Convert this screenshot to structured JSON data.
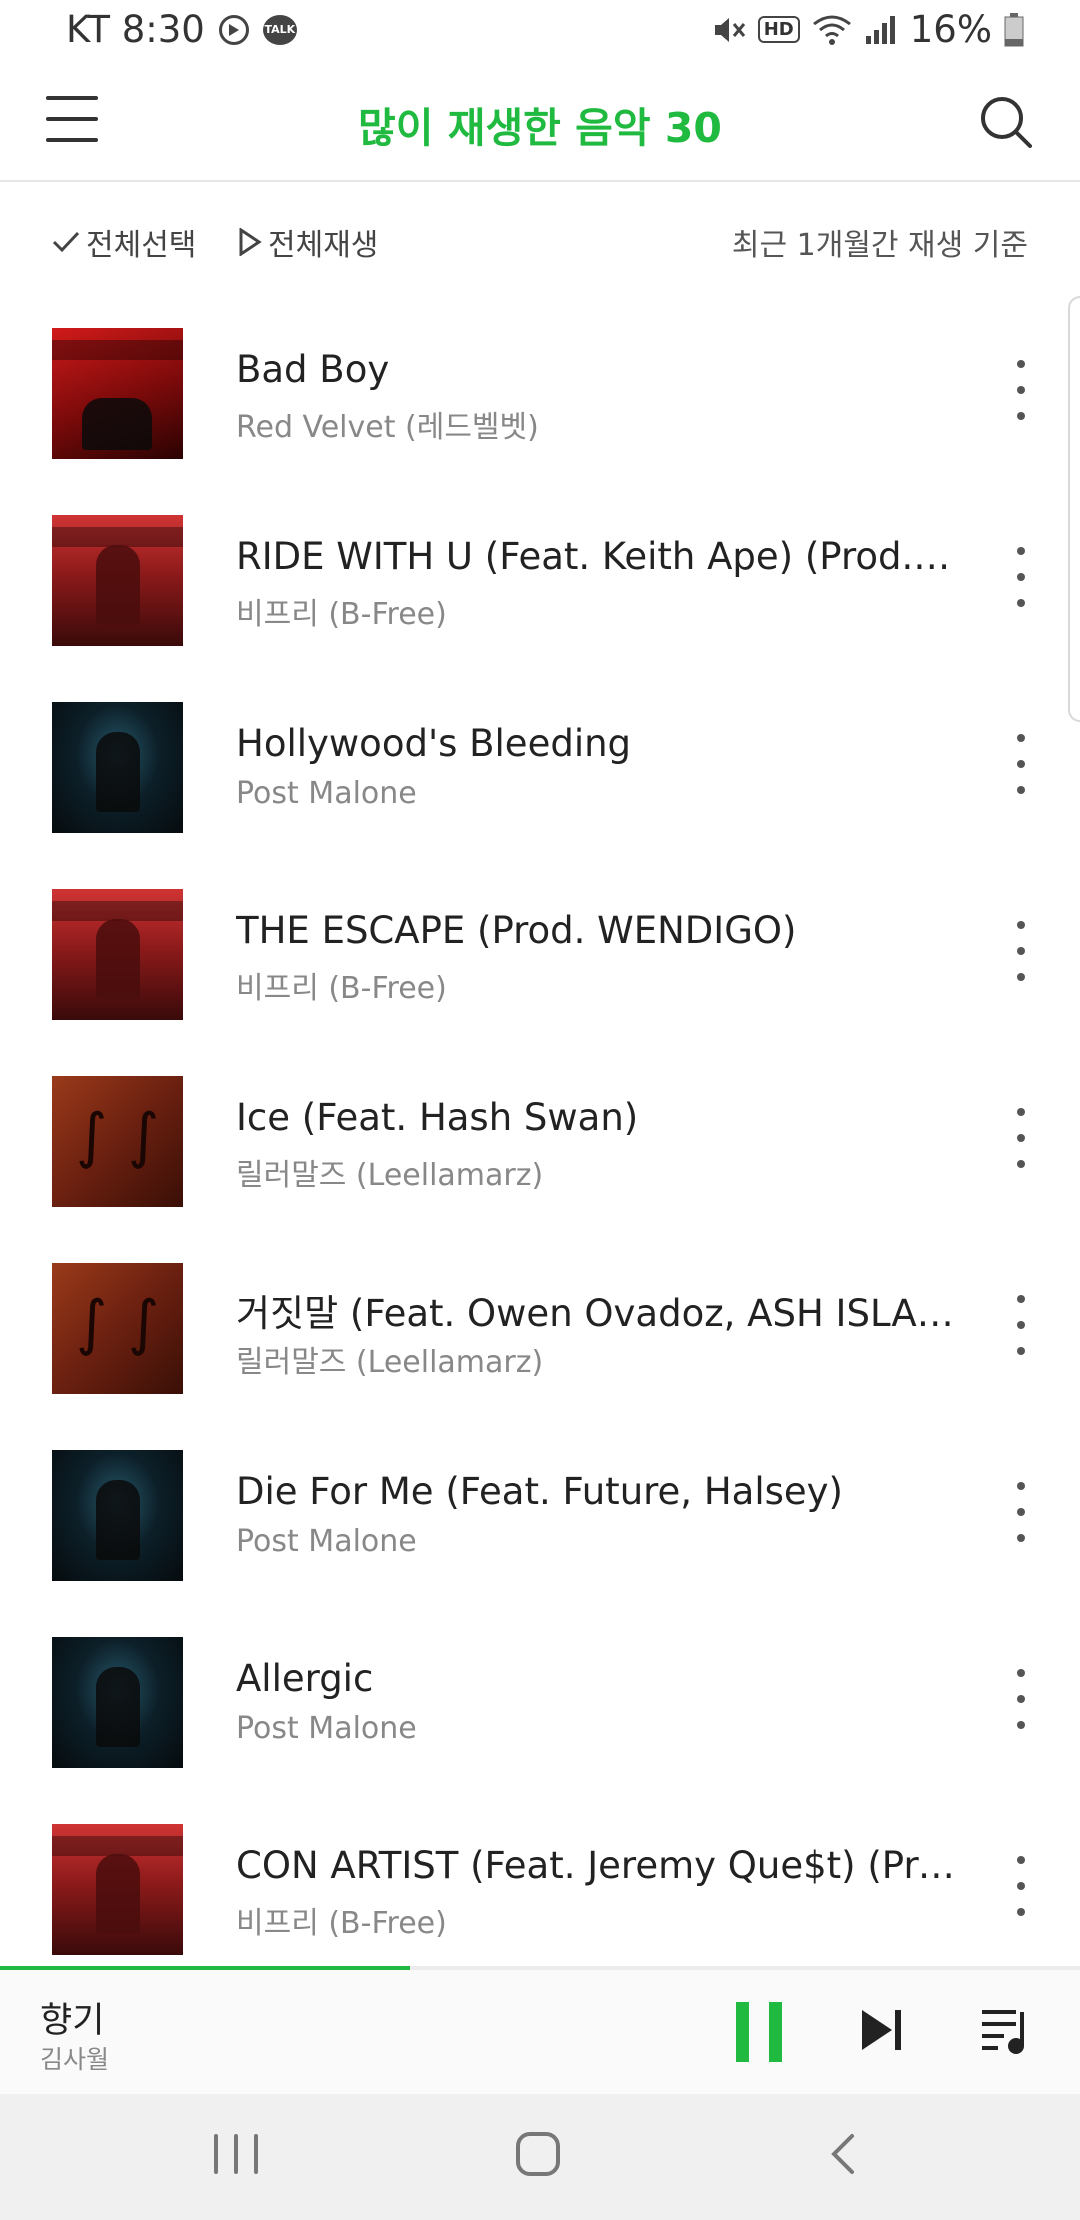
{
  "status_bar": {
    "carrier_time": "KT 8:30",
    "talk_badge": "TALK",
    "hd_badge": "HD",
    "battery": "16%"
  },
  "header": {
    "title": "많이 재생한 음악 30"
  },
  "toolbar": {
    "select_all": "전체선택",
    "play_all": "전체재생",
    "basis": "최근 1개월간 재생 기준"
  },
  "songs": [
    {
      "title": "Bad Boy",
      "artist": "Red Velvet (레드벨벳)"
    },
    {
      "title": "RIDE WITH U (Feat. Keith Ape) (Prod. C...",
      "artist": "비프리 (B-Free)"
    },
    {
      "title": "Hollywood's Bleeding",
      "artist": "Post Malone"
    },
    {
      "title": "THE ESCAPE (Prod. WENDIGO)",
      "artist": "비프리 (B-Free)"
    },
    {
      "title": "Ice (Feat. Hash Swan)",
      "artist": "릴러말즈 (Leellamarz)"
    },
    {
      "title": "거짓말 (Feat. Owen Ovadoz, ASH ISLAND)",
      "artist": "릴러말즈 (Leellamarz)"
    },
    {
      "title": "Die For Me (Feat. Future, Halsey)",
      "artist": "Post Malone"
    },
    {
      "title": "Allergic",
      "artist": "Post Malone"
    },
    {
      "title": "CON ARTIST (Feat. Jeremy Que$t) (Pro...",
      "artist": "비프리 (B-Free)"
    }
  ],
  "now_playing": {
    "title": "향기",
    "artist": "김사월",
    "progress_fraction": 0.38
  },
  "colors": {
    "accent": "#1fba3f"
  }
}
